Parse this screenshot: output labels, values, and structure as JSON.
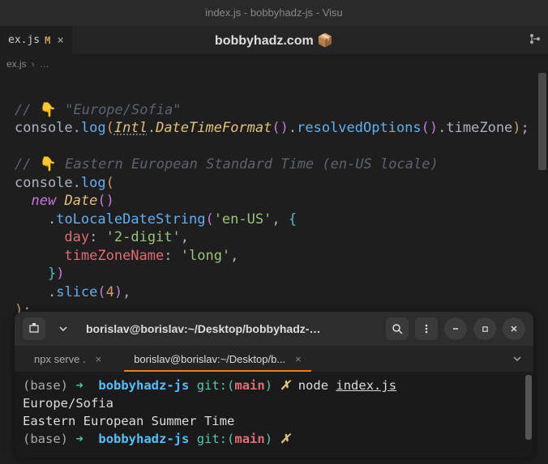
{
  "window": {
    "title": "index.js - bobbyhadz-js - Visu"
  },
  "tab": {
    "name": "ex.js",
    "modified": "M"
  },
  "headerTitle": "bobbyhadz.com",
  "breadcrumb": {
    "file": "ex.js",
    "more": "…"
  },
  "code": {
    "c1_pointer": "👇",
    "c1_text": " \"Europe/Sofia\"",
    "l2_console": "console",
    "l2_log": "log",
    "l2_intl": "Intl",
    "l2_dtf": "DateTimeFormat",
    "l2_resolved": "resolvedOptions",
    "l2_tz": "timeZone",
    "c2_pointer": "👇",
    "c2_text": " Eastern European Standard Time (en-US locale)",
    "l6_new": "new",
    "l6_date": "Date",
    "l7_method": "toLocaleDateString",
    "l7_arg": "'en-US'",
    "l8_key": "day",
    "l8_val": "'2-digit'",
    "l9_key": "timeZoneName",
    "l9_val": "'long'",
    "l11_slice": "slice",
    "l11_arg": "4"
  },
  "terminal": {
    "title": "borislav@borislav:~/Desktop/bobbyhadz-r...",
    "tabs": [
      {
        "label": "npx serve .",
        "active": false
      },
      {
        "label": "borislav@borislav:~/Desktop/b...",
        "active": true
      }
    ],
    "lines": {
      "prompt_base": "(base)",
      "prompt_arrow": "➜",
      "prompt_dir": "bobbyhadz-js",
      "prompt_git": "git:(",
      "prompt_branch": "main",
      "prompt_gitclose": ")",
      "prompt_x": "✗",
      "cmd_node": "node",
      "cmd_file": "index.js",
      "out1": "Europe/Sofia",
      "out2": "Eastern European Summer Time"
    }
  }
}
